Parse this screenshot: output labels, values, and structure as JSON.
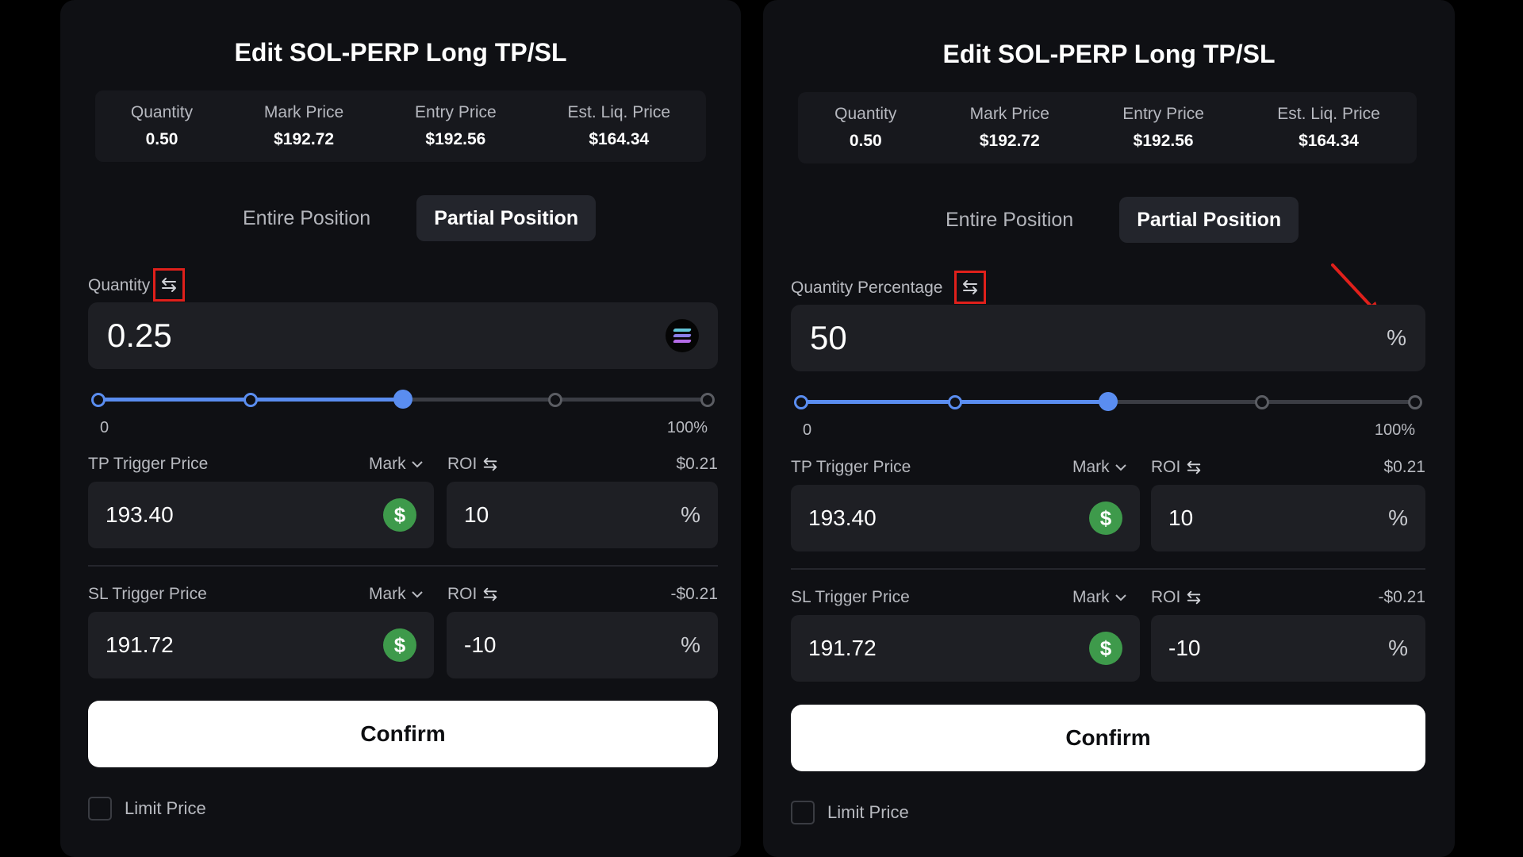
{
  "left": {
    "title": "Edit SOL-PERP Long TP/SL",
    "info": [
      {
        "label": "Quantity",
        "value": "0.50"
      },
      {
        "label": "Mark Price",
        "value": "$192.72"
      },
      {
        "label": "Entry Price",
        "value": "$192.56"
      },
      {
        "label": "Est. Liq. Price",
        "value": "$164.34"
      }
    ],
    "tabs": {
      "entire": "Entire Position",
      "partial": "Partial Position",
      "active": "partial"
    },
    "quantity": {
      "label": "Quantity",
      "value": "0.25",
      "unit_icon": "solana-icon"
    },
    "slider": {
      "min_label": "0",
      "max_label": "100%",
      "value_fraction": 0.5
    },
    "tp": {
      "label": "TP Trigger Price",
      "price_type": "Mark",
      "roi_label": "ROI",
      "pnl": "$0.21",
      "price": "193.40",
      "roi": "10",
      "roi_unit": "%"
    },
    "sl": {
      "label": "SL Trigger Price",
      "price_type": "Mark",
      "roi_label": "ROI",
      "pnl": "-$0.21",
      "price": "191.72",
      "roi": "-10",
      "roi_unit": "%"
    },
    "confirm": "Confirm",
    "limit_price": "Limit Price"
  },
  "right": {
    "title": "Edit SOL-PERP Long TP/SL",
    "info": [
      {
        "label": "Quantity",
        "value": "0.50"
      },
      {
        "label": "Mark Price",
        "value": "$192.72"
      },
      {
        "label": "Entry Price",
        "value": "$192.56"
      },
      {
        "label": "Est. Liq. Price",
        "value": "$164.34"
      }
    ],
    "tabs": {
      "entire": "Entire Position",
      "partial": "Partial Position",
      "active": "partial"
    },
    "quantity": {
      "label": "Quantity Percentage",
      "value": "50",
      "unit": "%"
    },
    "slider": {
      "min_label": "0",
      "max_label": "100%",
      "value_fraction": 0.5
    },
    "tp": {
      "label": "TP Trigger Price",
      "price_type": "Mark",
      "roi_label": "ROI",
      "pnl": "$0.21",
      "price": "193.40",
      "roi": "10",
      "roi_unit": "%"
    },
    "sl": {
      "label": "SL Trigger Price",
      "price_type": "Mark",
      "roi_label": "ROI",
      "pnl": "-$0.21",
      "price": "191.72",
      "roi": "-10",
      "roi_unit": "%"
    },
    "confirm": "Confirm",
    "limit_price": "Limit Price"
  },
  "colors": {
    "accent": "#5a8df0",
    "highlight": "#e0201b",
    "dollar": "#3e9a4b"
  }
}
